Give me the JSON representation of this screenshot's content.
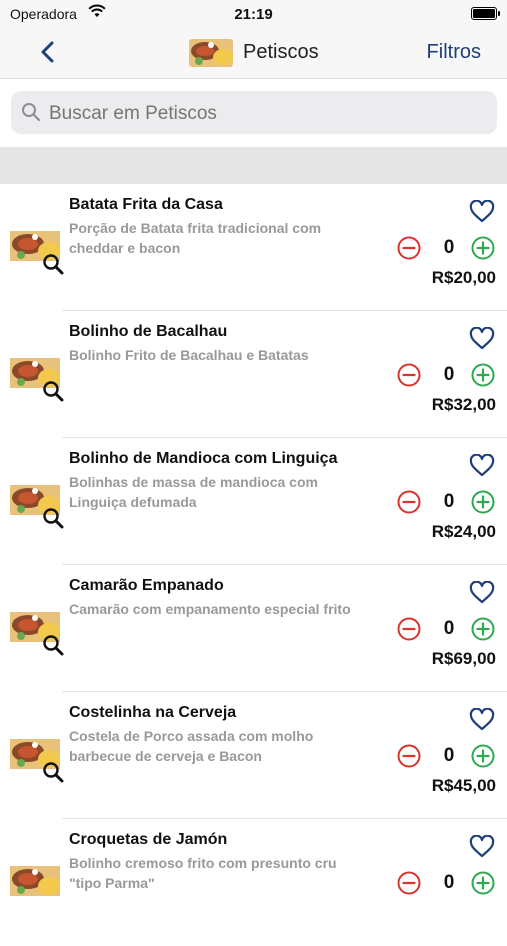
{
  "status_bar": {
    "carrier": "Operadora",
    "time": "21:19"
  },
  "nav": {
    "title": "Petiscos",
    "filters_label": "Filtros",
    "back_icon": "chevron-left-icon"
  },
  "search": {
    "placeholder": "Buscar em Petiscos",
    "value": ""
  },
  "colors": {
    "accent": "#1f3f7a",
    "minus": "#d9342b",
    "plus": "#2fa84f",
    "heart": "#1f3f7a"
  },
  "items": [
    {
      "name": "Batata Frita da Casa",
      "description": "Porção de Batata frita tradicional com cheddar e bacon",
      "quantity": "0",
      "price": "R$20,00"
    },
    {
      "name": "Bolinho de Bacalhau",
      "description": "Bolinho Frito de Bacalhau e Batatas",
      "quantity": "0",
      "price": "R$32,00"
    },
    {
      "name": "Bolinho de Mandioca com Linguiça",
      "description": "Bolinhas de massa de mandioca com Linguiça defumada",
      "quantity": "0",
      "price": "R$24,00"
    },
    {
      "name": "Camarão Empanado",
      "description": "Camarão com empanamento especial frito",
      "quantity": "0",
      "price": "R$69,00"
    },
    {
      "name": "Costelinha na Cerveja",
      "description": "Costela de Porco assada com molho barbecue de cerveja e Bacon",
      "quantity": "0",
      "price": "R$45,00"
    },
    {
      "name": "Croquetas de Jamón",
      "description": "Bolinho cremoso frito com presunto cru \"tipo Parma\"",
      "quantity": "0",
      "price": ""
    }
  ]
}
